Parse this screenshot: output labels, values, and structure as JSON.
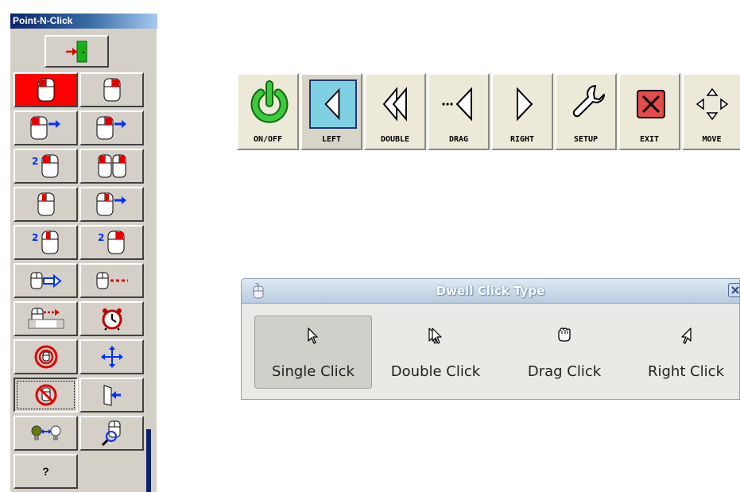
{
  "point_n_click": {
    "title": "Point-N-Click",
    "help_label": "?",
    "colors": {
      "titlebar": "#0a246a",
      "selected": "#ff0000",
      "arrow": "#0000ff",
      "panel": "#d4d0c8"
    },
    "buttons": [
      "exit-door-icon",
      "left-click-mouse-icon",
      "right-click-mouse-icon",
      "left-click-continue-icon",
      "right-click-continue-icon",
      "double-left-click-icon",
      "both-buttons-mouse-icon",
      "left-drag-mouse-icon",
      "right-drag-arrow-icon",
      "double-click-mouse-icon",
      "double-right-click-icon",
      "drag-to-target-icon",
      "drag-dashed-icon",
      "slow-drag-icon",
      "alarm-clock-icon",
      "target-icon",
      "move-arrows-icon",
      "no-click-icon",
      "exit-left-icon",
      "toggle-bulb-icon",
      "magnify-mouse-icon"
    ]
  },
  "toolbar": {
    "buttons": [
      {
        "label": "ON/OFF",
        "icon": "power-icon"
      },
      {
        "label": "LEFT",
        "icon": "left-triangle-icon",
        "active": true
      },
      {
        "label": "DOUBLE",
        "icon": "double-left-icon"
      },
      {
        "label": "DRAG",
        "icon": "drag-left-icon"
      },
      {
        "label": "RIGHT",
        "icon": "right-triangle-icon"
      },
      {
        "label": "SETUP",
        "icon": "wrench-icon"
      },
      {
        "label": "EXIT",
        "icon": "exit-x-icon"
      },
      {
        "label": "MOVE",
        "icon": "move-arrows-icon"
      }
    ],
    "colors": {
      "power": "#2ea82e",
      "active": "#7fd0e3",
      "exit": "#e03a3a"
    }
  },
  "dwell": {
    "title": "Dwell Click Type",
    "buttons": [
      {
        "label": "Single Click",
        "icon": "pointer-arrow-icon",
        "selected": true
      },
      {
        "label": "Double Click",
        "icon": "double-pointer-icon"
      },
      {
        "label": "Drag Click",
        "icon": "grab-hand-icon"
      },
      {
        "label": "Right Click",
        "icon": "right-pointer-icon"
      }
    ]
  }
}
